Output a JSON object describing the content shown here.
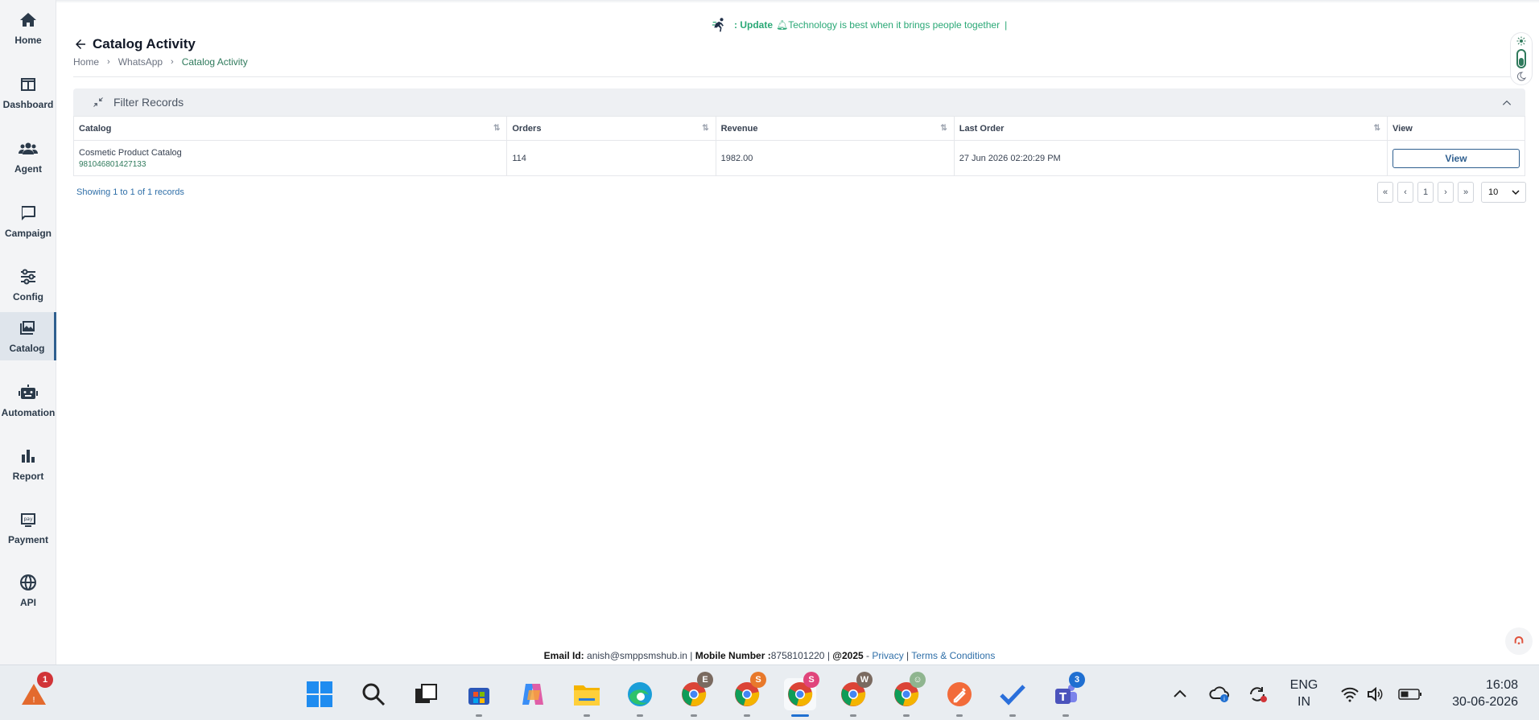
{
  "sidebar": {
    "items": [
      {
        "label": "Home",
        "icon": "home-icon"
      },
      {
        "label": "Dashboard",
        "icon": "dashboard-icon"
      },
      {
        "label": "Agent",
        "icon": "users-icon"
      },
      {
        "label": "Campaign",
        "icon": "chat-bubble-icon"
      },
      {
        "label": "Config",
        "icon": "sliders-icon"
      },
      {
        "label": "Catalog",
        "icon": "images-icon",
        "active": true
      },
      {
        "label": "Automation",
        "icon": "robot-icon"
      },
      {
        "label": "Report",
        "icon": "bar-chart-icon"
      },
      {
        "label": "Payment",
        "icon": "pay-card-icon"
      },
      {
        "label": "API",
        "icon": "globe-icon"
      }
    ]
  },
  "header": {
    "marquee_label": ": Update",
    "marquee_text": "Technology is best when it brings people together",
    "title": "Catalog Activity",
    "breadcrumb": [
      "Home",
      "WhatsApp",
      "Catalog Activity"
    ]
  },
  "filter": {
    "label": "Filter Records"
  },
  "table": {
    "columns": [
      "Catalog",
      "Orders",
      "Revenue",
      "Last Order",
      "View"
    ],
    "rows": [
      {
        "catalog_name": "Cosmetic Product Catalog",
        "catalog_id": "981046801427133",
        "orders": "114",
        "revenue": "1982.00",
        "last_order": "27 Jun 2026 02:20:29 PM",
        "view_label": "View"
      }
    ]
  },
  "pagination": {
    "showing": "Showing 1 to 1 of 1 records",
    "first": "«",
    "prev": "‹",
    "page": "1",
    "next": "›",
    "last": "»",
    "per_page": "10"
  },
  "footer": {
    "email_label": "Email Id:",
    "email": "anish@smppsmshub.in",
    "mobile_label": "Mobile Number :",
    "mobile": "8758101220",
    "year": "@2025",
    "privacy": "Privacy",
    "terms": "Terms & Conditions"
  },
  "taskbar": {
    "notification_count": "1",
    "teams_badge": "3",
    "chrome_profiles": [
      "E",
      "S",
      "S",
      "W"
    ],
    "lang_top": "ENG",
    "lang_bottom": "IN",
    "time": "16:08",
    "date": "30-06-2026"
  },
  "colors": {
    "accent_green": "#2aa876",
    "active_blue": "#2f5f8f",
    "link_blue": "#2f6fa8"
  }
}
